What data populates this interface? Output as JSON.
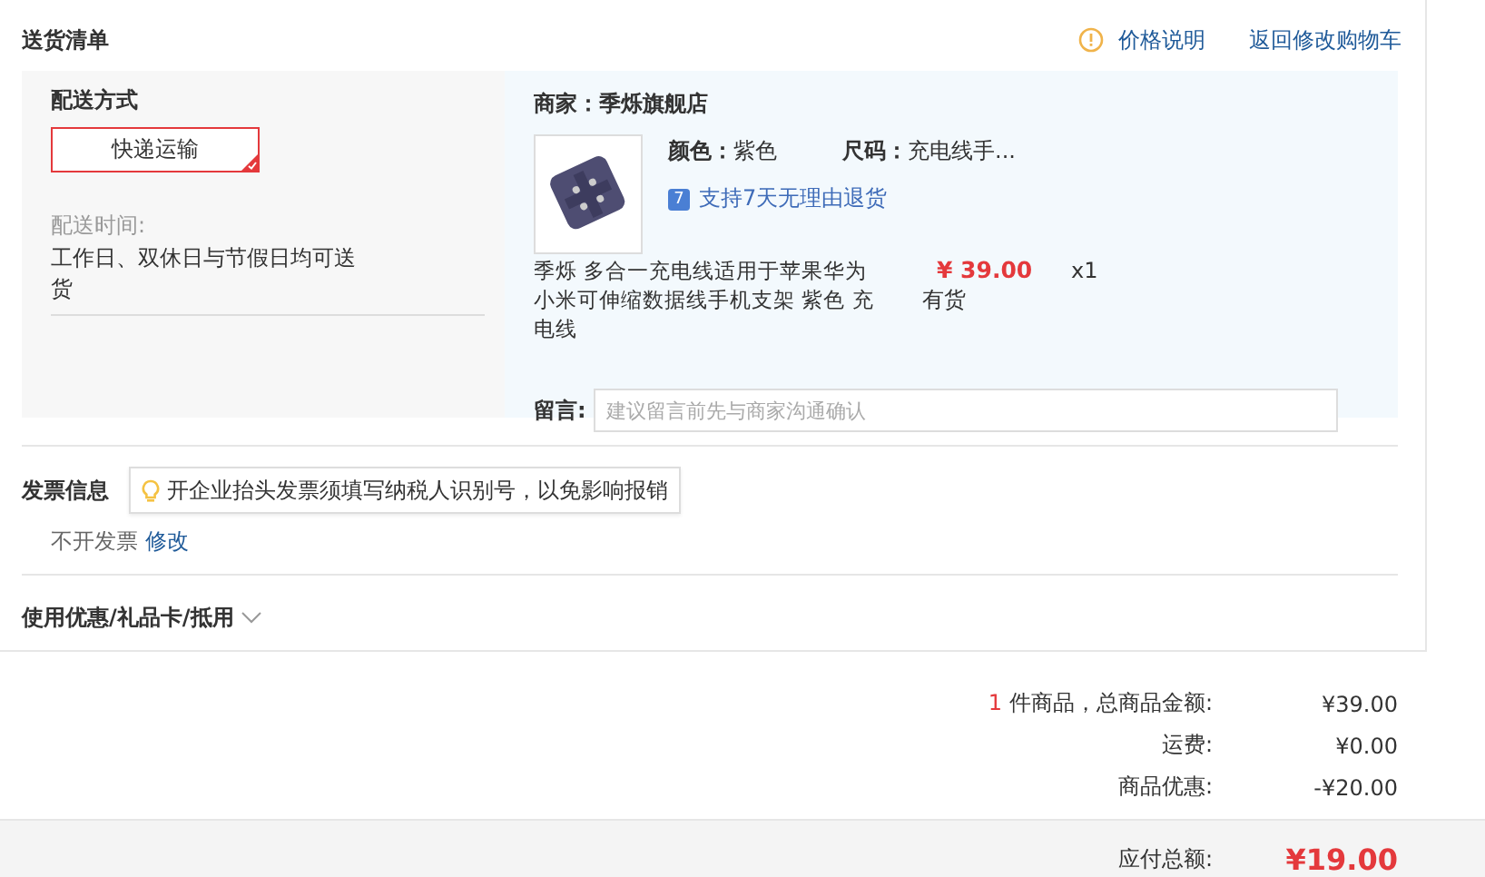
{
  "section_title": "送货清单",
  "header_links": [
    {
      "kind": "info",
      "label": "价格说明"
    },
    {
      "kind": "plain",
      "label": "返回修改购物车"
    }
  ],
  "shipping": {
    "title": "配送方式",
    "options": [
      {
        "label": "快递运输",
        "selected": true
      }
    ],
    "time_label": "配送时间:",
    "time_value": "工作日、双休日与节假日均可送货"
  },
  "seller": {
    "label": "商家：",
    "name": "季烁旗舰店"
  },
  "product": {
    "attrs": [
      {
        "label": "颜色：",
        "value": "紫色"
      },
      {
        "label": "尺码：",
        "value": "充电线手..."
      }
    ],
    "return_badge": "7",
    "return_policy": "支持7天无理由退货",
    "title": "季烁 多合一充电线适用于苹果华为小米可伸缩数据线手机支架 紫色 充电线",
    "price": "¥ 39.00",
    "stock": "有货",
    "quantity": "x1"
  },
  "message": {
    "label": "留言:",
    "placeholder": "建议留言前先与商家沟通确认"
  },
  "invoice": {
    "title": "发票信息",
    "tip": "开企业抬头发票须填写纳税人识别号，以免影响报销",
    "value": "不开发票",
    "edit_link": "修改"
  },
  "coupons": {
    "label": "使用优惠/礼品卡/抵用",
    "expanded": false
  },
  "summary": [
    {
      "count": "1",
      "label": "件商品，总商品金额:",
      "value": "¥39.00"
    },
    {
      "label": "运费:",
      "value": "¥0.00"
    },
    {
      "label": "商品优惠:",
      "value": "-¥20.00"
    }
  ],
  "total": {
    "label": "应付总额:",
    "value": "¥19.00"
  }
}
